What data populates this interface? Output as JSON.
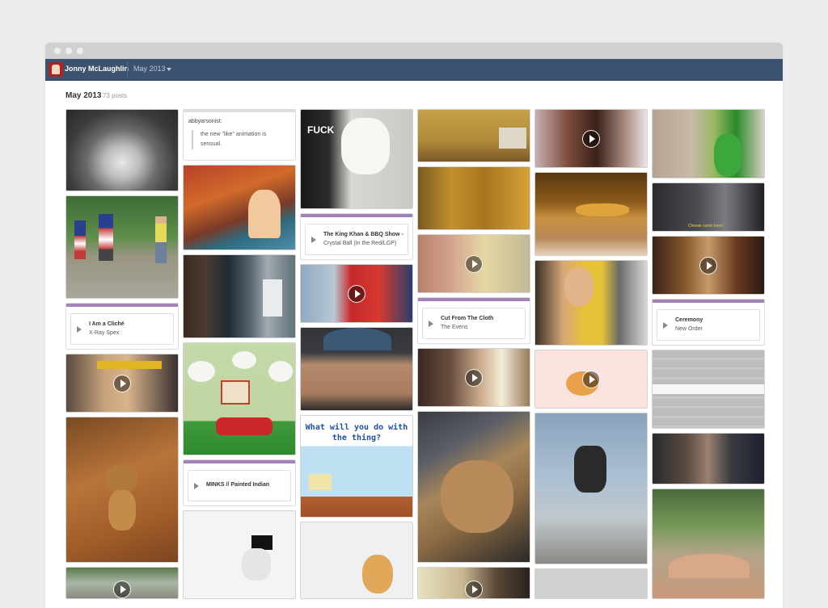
{
  "topbar": {
    "username": "Jonny McLaughlin",
    "month_selector": "May 2013"
  },
  "page": {
    "heading": "May 2013",
    "post_count": "73 posts"
  },
  "text_post": {
    "author": "abbyarsonist:",
    "quote_line1": "the new \"like\" animation is",
    "quote_line2": "sensual."
  },
  "audio_posts": [
    {
      "title": "I Am a Cliché",
      "artist": "X-Ray Spex"
    },
    {
      "title": "The King Khan & BBQ Show -",
      "artist": "Crystal Ball (In the Red/LGP)"
    },
    {
      "title": "Cut From The Cloth",
      "artist": "The Evens"
    },
    {
      "title": "Ceremony",
      "artist": "New Order"
    },
    {
      "title": "MINKS // Painted Indian",
      "artist": ""
    }
  ],
  "image_text": {
    "fuck": "FUCK",
    "game_line1": "What will you do with",
    "game_line2": "the thing?",
    "caption": "Chewie come here!"
  },
  "colors": {
    "topbar": "#3b5270",
    "audio_bar": "#a482b8",
    "background": "#ececec"
  }
}
